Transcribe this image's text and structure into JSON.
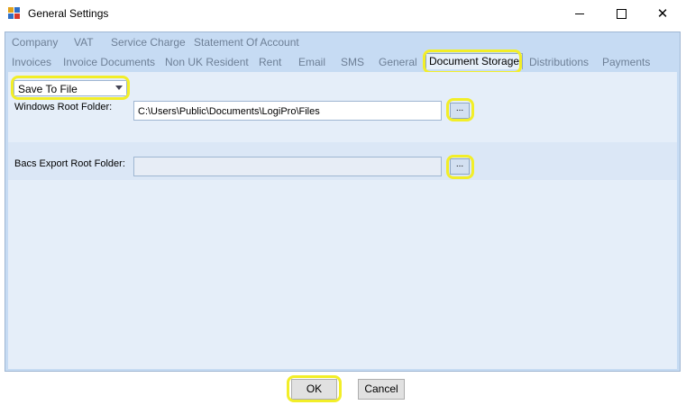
{
  "window": {
    "title": "General Settings",
    "icon": "app-window-icon",
    "controls": [
      "minimize-icon",
      "maximize-icon",
      "close-icon"
    ],
    "close_glyph": "✕"
  },
  "tabs": {
    "row1": [
      "Company",
      "VAT",
      "Service Charge",
      "Statement Of Account"
    ],
    "row2": [
      "Invoices",
      "Invoice Documents",
      "Non UK Resident",
      "Rent",
      "Email",
      "SMS",
      "General",
      "Document Storage",
      "Distributions",
      "Payments"
    ],
    "active": "Document Storage"
  },
  "storage": {
    "mode_value": "Save To File",
    "windows_root_label": "Windows Root Folder:",
    "windows_root_value": "C:\\Users\\Public\\Documents\\LogiPro\\Files",
    "bacs_root_label": "Bacs Export Root Folder:",
    "bacs_root_value": "",
    "browse_label": "..."
  },
  "footer": {
    "ok_label": "OK",
    "cancel_label": "Cancel"
  },
  "colors": {
    "highlight": "#f2ee28",
    "panel": "#c6dbf3",
    "content": "#e5eef9"
  }
}
